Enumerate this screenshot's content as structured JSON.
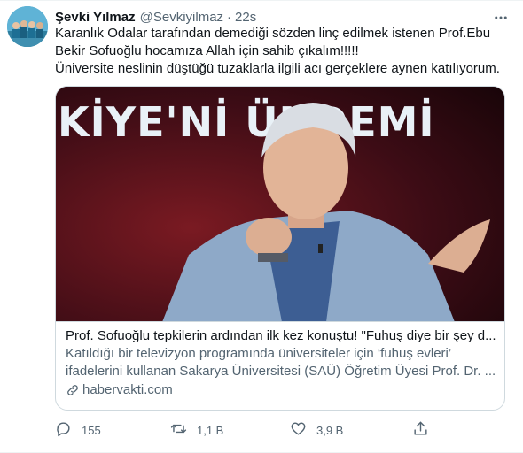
{
  "tweet": {
    "author": {
      "display_name": "Şevki Yılmaz",
      "handle": "@Sevkiyilmaz",
      "separator": "·",
      "time": "22s",
      "avatar_icon": "group-photo-avatar"
    },
    "more_icon": "more-horizontal-icon",
    "text_lines": [
      "Karanlık Odalar tarafından demediği sözden linç edilmek istenen Prof.Ebu",
      "Bekir Sofuoğlu hocamıza Allah için sahib çıkalım!!!!!",
      "Üniversite neslinin düştüğü tuzaklarla ilgili  acı gerçeklere aynen katılıyorum."
    ],
    "card": {
      "image_banner": "KİYE'Nİ   ÜNDEMİ",
      "title": "Prof. Sofuoğlu tepkilerin ardından ilk kez konuştu! \"Fuhuş diye bir şey d...",
      "description_lines": [
        "Katıldığı bir televizyon programında üniversiteler için ‘fuhuş evleri’",
        "ifadelerini kullanan Sakarya Üniversitesi (SAÜ) Öğretim Üyesi Prof. Dr. ..."
      ],
      "domain": "habervakti.com",
      "domain_icon": "link-icon"
    },
    "actions": {
      "reply": {
        "icon": "reply-icon",
        "count": "155"
      },
      "retweet": {
        "icon": "retweet-icon",
        "count": "1,1 B"
      },
      "like": {
        "icon": "heart-icon",
        "count": "3,9 B"
      },
      "share": {
        "icon": "share-icon",
        "count": ""
      }
    },
    "colors": {
      "text": "#0f1419",
      "secondary": "#536471",
      "border": "#cfd9de",
      "banner_background": "#3a0b14",
      "banner_text": "#e9f1f7"
    }
  }
}
